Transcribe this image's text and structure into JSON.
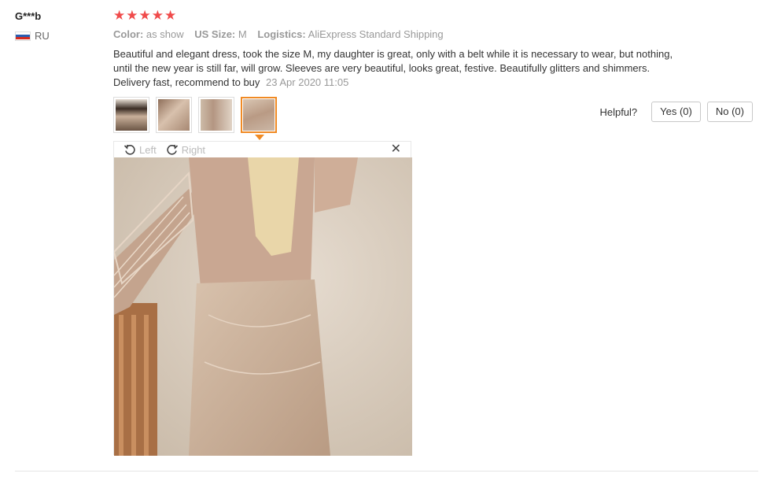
{
  "user": {
    "name": "G***b",
    "country": "RU"
  },
  "review": {
    "stars": "★★★★★",
    "attributes": [
      {
        "key": "Color:",
        "value": "as show"
      },
      {
        "key": "US Size:",
        "value": "M"
      },
      {
        "key": "Logistics:",
        "value": "AliExpress Standard Shipping"
      }
    ],
    "text": "Beautiful and elegant dress, took the size M, my daughter is great, only with a belt while it is necessary to wear, but nothing, until the new year is still far, will grow. Sleeves are very beautiful, looks great, festive. Beautifully glitters and shimmers. Delivery fast, recommend to buy",
    "date": "23 Apr 2020 11:05"
  },
  "helpful": {
    "label": "Helpful?",
    "yes": "Yes (0)",
    "no": "No (0)"
  },
  "viewer": {
    "left_label": "Left",
    "right_label": "Right",
    "close": "✕"
  },
  "colors": {
    "star": "#f04b4b",
    "active_thumb": "#f08a24"
  }
}
